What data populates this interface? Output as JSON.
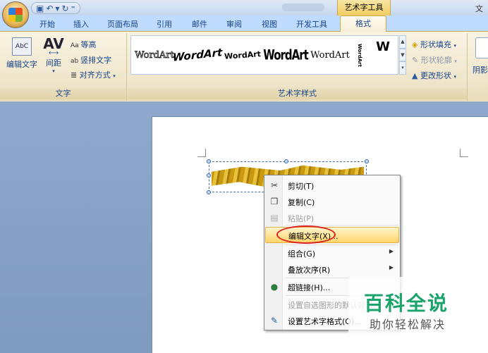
{
  "title_bar": {
    "contextual_tool": "艺术字工具",
    "document_title": "文档"
  },
  "tabs": [
    "开始",
    "插入",
    "页面布局",
    "引用",
    "邮件",
    "审阅",
    "视图",
    "开发工具"
  ],
  "active_tab": "格式",
  "ribbon": {
    "text_group": {
      "label": "文字",
      "edit_text": "编辑文字",
      "spacing": "间距",
      "equal_height": "等高",
      "vertical_text": "竖排文字",
      "align": "对齐方式"
    },
    "styles_group": {
      "label": "艺术字样式",
      "items": [
        "WordArt",
        "WordArt",
        "WordArt",
        "WordArt",
        "WordArt",
        "WordArt",
        "W"
      ],
      "shape_fill": "形状填充",
      "shape_outline": "形状轮廓",
      "change_shape": "更改形状"
    },
    "shadow_group": {
      "label": "阴影"
    }
  },
  "context_menu": {
    "items": [
      {
        "label": "剪切(T)",
        "icon": "scissors-icon",
        "enabled": true
      },
      {
        "label": "复制(C)",
        "icon": "copy-icon",
        "enabled": true
      },
      {
        "label": "粘贴(P)",
        "icon": "paste-icon",
        "enabled": false
      },
      {
        "label": "编辑文字(X)...",
        "icon": "",
        "enabled": true,
        "highlighted": true
      },
      {
        "label": "组合(G)",
        "icon": "",
        "enabled": true,
        "submenu": true
      },
      {
        "label": "叠放次序(R)",
        "icon": "",
        "enabled": true,
        "submenu": true
      },
      {
        "label": "超链接(H)...",
        "icon": "hyperlink-icon",
        "enabled": true
      },
      {
        "label": "设置自选图形的默认效果(I)",
        "icon": "",
        "enabled": false
      },
      {
        "label": "设置艺术字格式(O)...",
        "icon": "format-icon",
        "enabled": true
      }
    ]
  },
  "watermark": {
    "title": "百科全说",
    "subtitle": "助你轻松解决"
  }
}
